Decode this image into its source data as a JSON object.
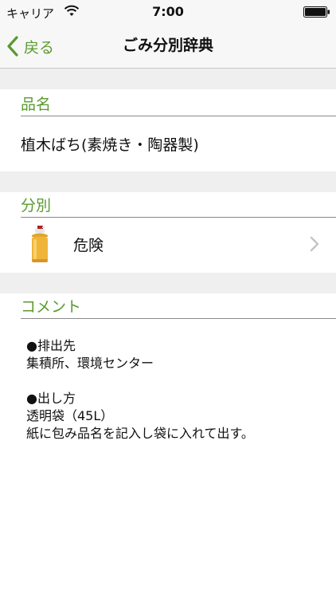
{
  "status_bar": {
    "carrier": "キャリア",
    "time": "7:00"
  },
  "nav": {
    "back_label": "戻る",
    "title": "ごみ分別辞典"
  },
  "sections": {
    "name_header": "品名",
    "item_name": "植木ばち(素焼き・陶器製)",
    "category_header": "分別",
    "category_label": "危険",
    "comment_header": "コメント"
  },
  "comment": {
    "lines": [
      "●排出先",
      "集積所、環境センター",
      "●出し方",
      "透明袋（45L）",
      "紙に包み品名を記入し袋に入れて出す。"
    ]
  },
  "colors": {
    "accent": "#5a9a2e",
    "gap_background": "#efefef",
    "bar_background": "#f7f7f7"
  },
  "icons": {
    "status": [
      "wifi-icon",
      "battery-icon"
    ],
    "nav": "chevron-left-icon",
    "category": "spray-can-icon",
    "disclosure": "chevron-right-icon"
  }
}
